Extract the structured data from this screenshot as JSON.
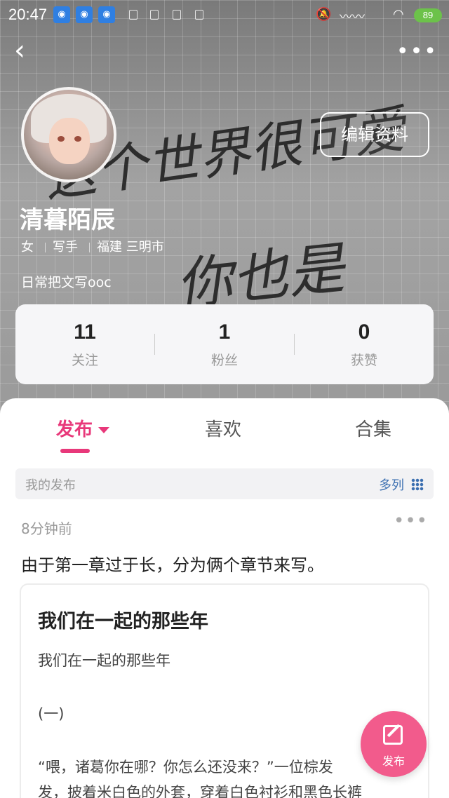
{
  "status": {
    "time": "20:47",
    "battery": "89"
  },
  "profile": {
    "name": "清暮陌辰",
    "gender": "女",
    "role": "写手",
    "location": "福建 三明市",
    "bio": "日常把文写ooc",
    "edit_label": "编辑资料"
  },
  "background_text": [
    "这个世界很可爱",
    "你也是"
  ],
  "stats": [
    {
      "num": "11",
      "label": "关注"
    },
    {
      "num": "1",
      "label": "粉丝"
    },
    {
      "num": "0",
      "label": "获赞"
    }
  ],
  "tabs": [
    {
      "label": "发布",
      "active": true
    },
    {
      "label": "喜欢"
    },
    {
      "label": "合集"
    }
  ],
  "subbar": {
    "title": "我的发布",
    "view_label": "多列"
  },
  "post": {
    "time": "8分钟前",
    "text": "由于第一章过于长，分为俩个章节来写。",
    "card_title": "我们在一起的那些年",
    "card_lines": [
      "我们在一起的那些年",
      "(一)",
      "“喂，诸葛你在哪？你怎么还没来？”一位棕发",
      "发，披着米白色的外套，穿着白色衬衫和黑色长裤"
    ]
  },
  "fab_label": "发布",
  "colors": {
    "accent": "#e8387a",
    "link": "#3b6fb0",
    "fab": "#f25b8c"
  }
}
